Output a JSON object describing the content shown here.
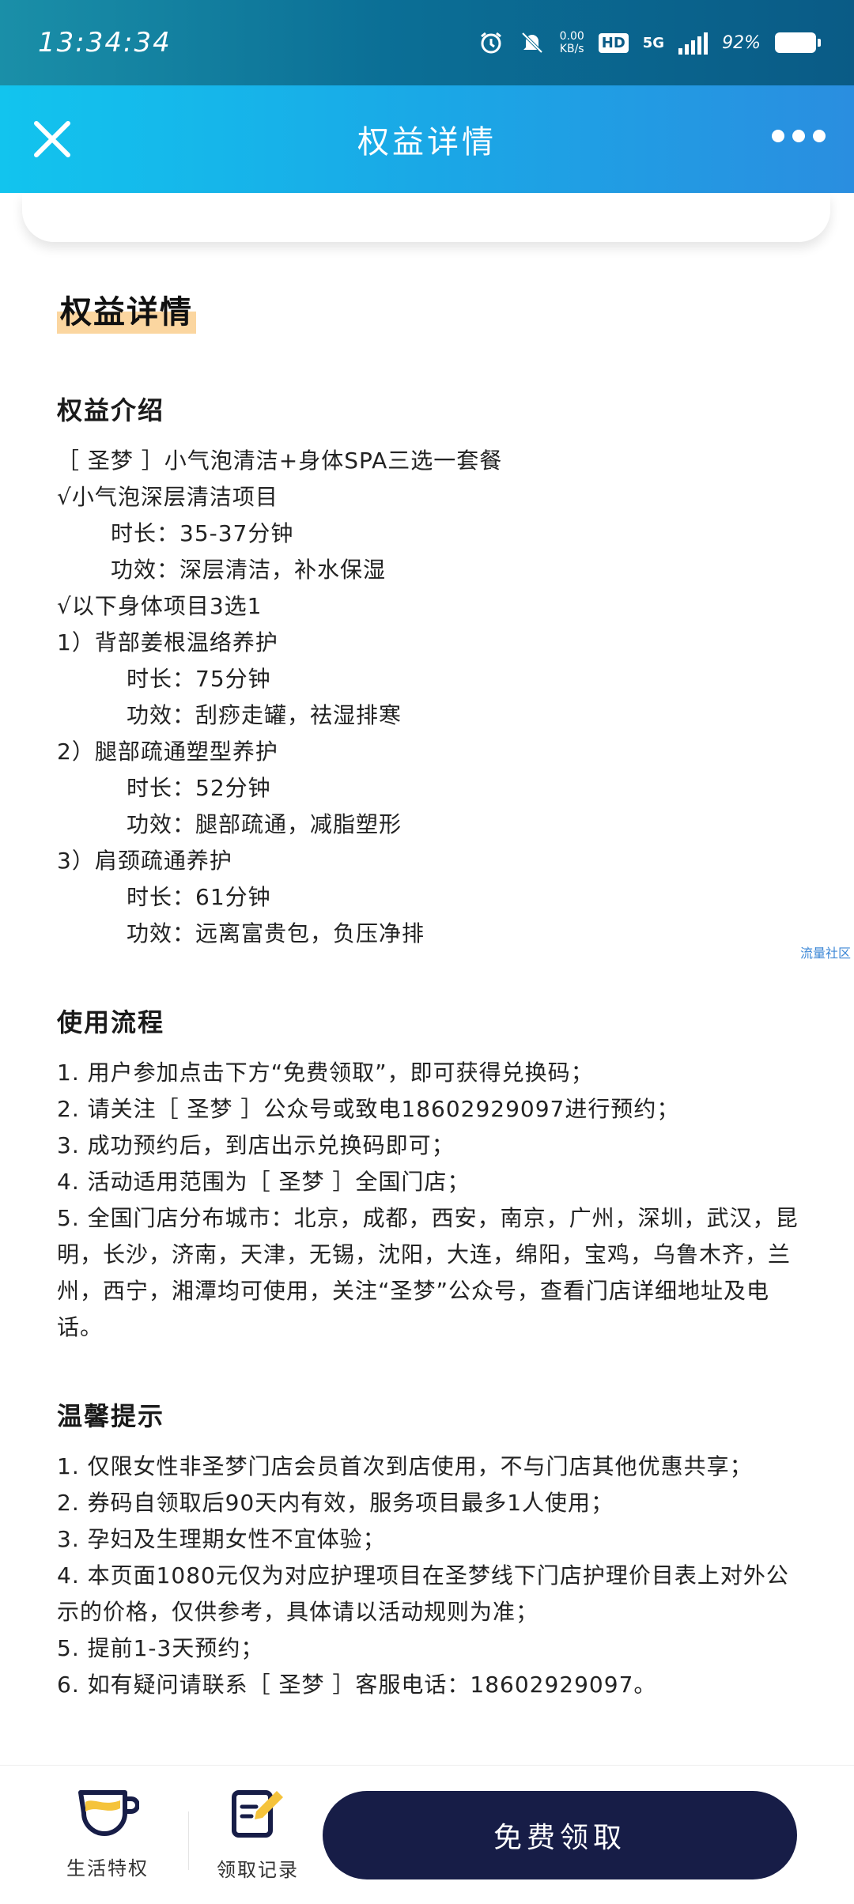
{
  "status_bar": {
    "time": "13:34:34",
    "net_speed": "0.00",
    "net_unit": "KB/s",
    "hd": "HD",
    "network": "5G",
    "battery": "92%"
  },
  "navbar": {
    "title": "权益详情"
  },
  "page": {
    "section_title": "权益详情",
    "intro": {
      "heading": "权益介绍",
      "lines": [
        "［ 圣梦 ］小气泡清洁+身体SPA三选一套餐",
        "√小气泡深层清洁项目",
        "时长：35-37分钟",
        "功效：深层清洁，补水保湿",
        "√以下身体项目3选1",
        "1）背部姜根温络养护",
        "时长：75分钟",
        "功效：刮痧走罐，祛湿排寒",
        "2）腿部疏通塑型养护",
        "时长：52分钟",
        "功效：腿部疏通，减脂塑形",
        "3）肩颈疏通养护",
        "时长：61分钟",
        "功效：远离富贵包，负压净排"
      ]
    },
    "process": {
      "heading": "使用流程",
      "items": [
        "1. 用户参加点击下方“免费领取”，即可获得兑换码；",
        "2. 请关注［ 圣梦 ］公众号或致电18602929097进行预约；",
        "3. 成功预约后，到店出示兑换码即可；",
        "4. 活动适用范围为［ 圣梦 ］全国门店；",
        "5. 全国门店分布城市：北京，成都，西安，南京，广州，深圳，武汉，昆明，长沙，济南，天津，无锡，沈阳，大连，绵阳，宝鸡，乌鲁木齐，兰州，西宁，湘潭均可使用，关注“圣梦”公众号，查看门店详细地址及电话。"
      ]
    },
    "tips": {
      "heading": "温馨提示",
      "items": [
        "1. 仅限女性非圣梦门店会员首次到店使用，不与门店其他优惠共享；",
        "2. 券码自领取后90天内有效，服务项目最多1人使用；",
        "3. 孕妇及生理期女性不宜体验；",
        "4. 本页面1080元仅为对应护理项目在圣梦线下门店护理价目表上对外公示的价格，仅供参考，具体请以活动规则为准；",
        "5. 提前1-3天预约；",
        "6. 如有疑问请联系［ 圣梦 ］客服电话：18602929097。"
      ]
    },
    "watermark": "流量社区"
  },
  "bottom_bar": {
    "tab_life": "生活特权",
    "tab_record": "领取记录",
    "claim_button": "免费领取"
  },
  "colors": {
    "navbar_start": "#12c4ee",
    "navbar_end": "#2a8ee0",
    "claim_button": "#171d47",
    "title_highlight": "#fbd6a0"
  }
}
